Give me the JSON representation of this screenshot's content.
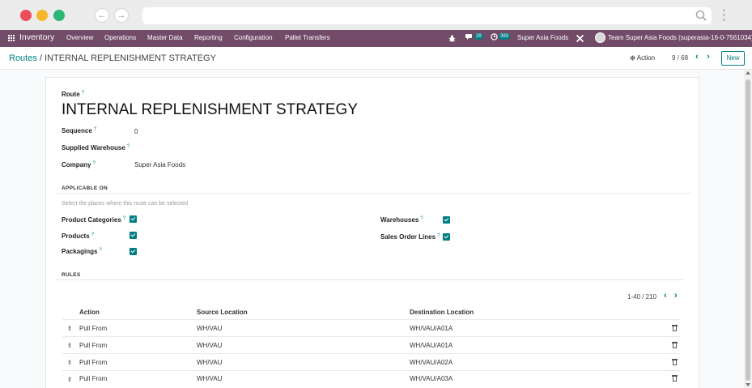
{
  "browser": {
    "url": ""
  },
  "navbar": {
    "app_name": "Inventory",
    "menu": [
      "Overview",
      "Operations",
      "Master Data",
      "Reporting",
      "Configuration",
      "Pallet Transfers"
    ],
    "messages_count": "29",
    "activities_count": "393",
    "company": "Super Asia Foods",
    "user": "Team Super Asia Foods (superasia-16-0-7561034)"
  },
  "control_panel": {
    "breadcrumb_parent": "Routes",
    "breadcrumb_separator": "/",
    "breadcrumb_current": "INTERNAL REPLENISHMENT STRATEGY",
    "action_label": "Action",
    "pager": "9 / 68",
    "new_label": "New"
  },
  "form": {
    "route_label": "Route",
    "route_name": "INTERNAL REPLENISHMENT STRATEGY",
    "sequence_label": "Sequence",
    "sequence_value": "0",
    "warehouse_label": "Supplied Warehouse",
    "warehouse_value": "",
    "company_label": "Company",
    "company_value": "Super Asia Foods",
    "help_mark": "?"
  },
  "applicable_on": {
    "section_title": "APPLICABLE ON",
    "hint": "Select the places where this route can be selected",
    "left": [
      {
        "label": "Product Categories",
        "checked": true
      },
      {
        "label": "Products",
        "checked": true
      },
      {
        "label": "Packagings",
        "checked": true
      }
    ],
    "right": [
      {
        "label": "Warehouses",
        "checked": true
      },
      {
        "label": "Sales Order Lines",
        "checked": true
      }
    ]
  },
  "rules": {
    "section_title": "RULES",
    "pager": "1-40 / 210",
    "columns": [
      "Action",
      "Source Location",
      "Destination Location"
    ],
    "rows": [
      {
        "action": "Pull From",
        "source": "WH/VAU",
        "destination": "WH/VAU/A01A"
      },
      {
        "action": "Pull From",
        "source": "WH/VAU",
        "destination": "WH/VAU/A01A"
      },
      {
        "action": "Pull From",
        "source": "WH/VAU",
        "destination": "WH/VAU/A02A"
      },
      {
        "action": "Pull From",
        "source": "WH/VAU",
        "destination": "WH/VAU/A03A"
      }
    ]
  },
  "colors": {
    "navbar": "#714b67",
    "accent": "#017e84"
  }
}
